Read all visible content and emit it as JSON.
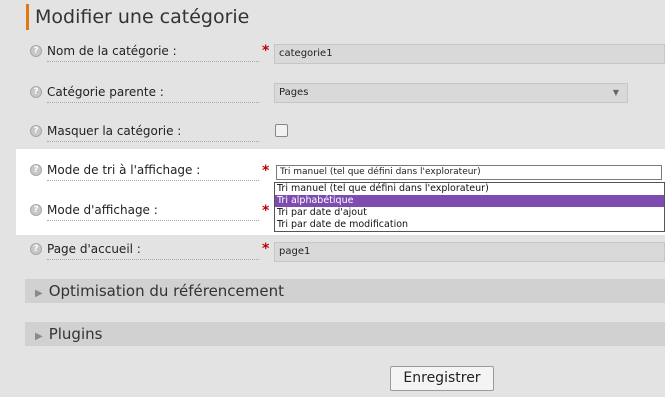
{
  "page": {
    "title": "Modifier une catégorie"
  },
  "form": {
    "name": {
      "label": "Nom de la catégorie :",
      "value": "categorie1",
      "required": "*"
    },
    "parent": {
      "label": "Catégorie parente :",
      "value": "Pages"
    },
    "hide": {
      "label": "Masquer la catégorie :",
      "checked": false
    },
    "sort": {
      "label": "Mode de tri à l'affichage :",
      "required": "*",
      "value": "Tri manuel (tel que défini dans l'explorateur)",
      "options": [
        "Tri manuel (tel que défini dans l'explorateur)",
        "Tri alphabétique",
        "Tri par date d'ajout",
        "Tri par date de modification"
      ],
      "highlighted_option": "Tri alphabétique"
    },
    "display": {
      "label": "Mode d'affichage :",
      "required": "*"
    },
    "homepage": {
      "label": "Page d'accueil :",
      "value": "page1",
      "required": "*"
    }
  },
  "sections": [
    {
      "label": "Optimisation du référencement"
    },
    {
      "label": "Plugins"
    }
  ],
  "actions": {
    "save_label": "Enregistrer"
  },
  "icons": {
    "help": "help-icon",
    "expand": "triangle-right-icon",
    "dropdown": "chevron-down-icon"
  },
  "colors": {
    "accent": "#e07a10",
    "required": "#c00000",
    "selected_option": "#7e4bb1"
  }
}
